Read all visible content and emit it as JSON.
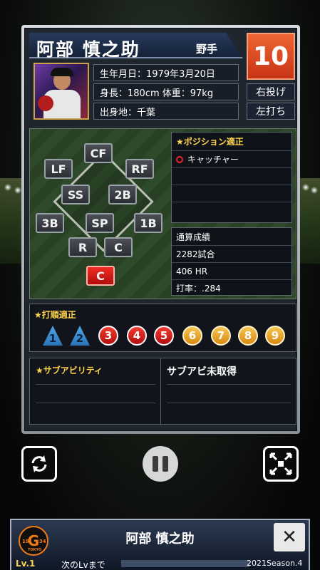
{
  "player": {
    "name": "阿部 慎之助",
    "role": "野手",
    "number": "10",
    "throws": "右投げ",
    "bats": "左打ち",
    "birthday": "生年月日：1979年3月20日",
    "body": "身長：180cm 体重：97kg",
    "hometown": "出身地：千葉"
  },
  "field": {
    "positions": {
      "cf": "CF",
      "lf": "LF",
      "rf": "RF",
      "ss": "SS",
      "b2": "2B",
      "b3": "3B",
      "sp": "SP",
      "b1": "1B",
      "r": "R",
      "c": "C",
      "c_active": "C"
    }
  },
  "position_aptitude": {
    "title": "★ポジション適正",
    "item": "キャッチャー"
  },
  "career": {
    "title": "通算成績",
    "games": "2282試合",
    "hr": "406 HR",
    "avg": "打率：.284"
  },
  "batting_order": {
    "title": "★打順適正",
    "numbers": [
      "1",
      "2",
      "3",
      "4",
      "5",
      "6",
      "7",
      "8",
      "9"
    ]
  },
  "sub_ability": {
    "title": "★サブアビリティ",
    "status": "サブアビ未取得"
  },
  "footer": {
    "logo_text": "G",
    "logo_year_a": "19",
    "logo_year_b": "34",
    "logo_tokyo": "TOKYO",
    "player_name": "阿部 慎之助",
    "level": "Lv.1",
    "next_level": "次のLvまで",
    "season": "2021Season.4"
  },
  "colors": {
    "accent_orange": "#ee6533",
    "gold": "#ffd34e",
    "active_red": "#e2292a"
  }
}
